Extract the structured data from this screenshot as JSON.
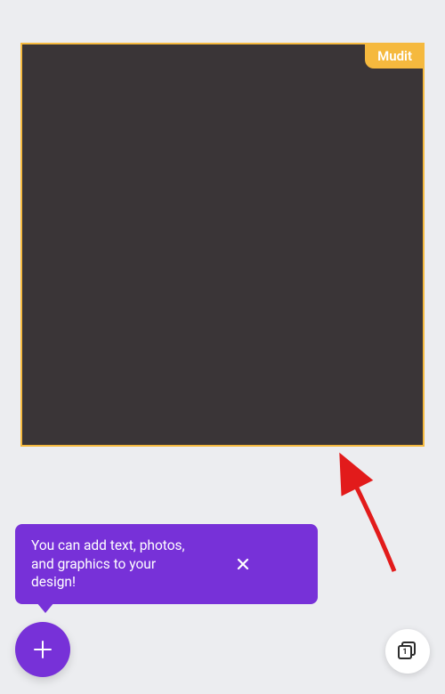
{
  "canvas": {
    "user_badge": "Mudit"
  },
  "tooltip": {
    "message": "You can add text, photos, and graphics to your design!"
  },
  "fab": {
    "label": "Add"
  },
  "pages": {
    "count": "1"
  }
}
